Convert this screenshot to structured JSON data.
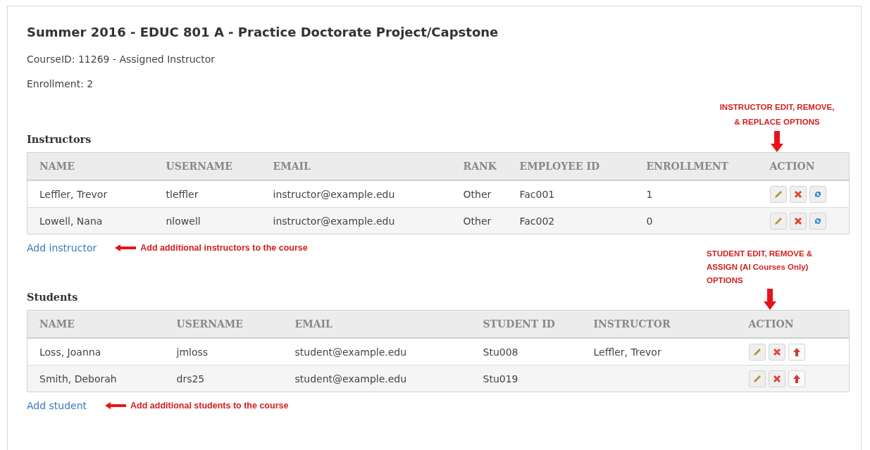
{
  "title": "Summer 2016 - EDUC 801 A - Practice Doctorate Project/Capstone",
  "course_info": "CourseID: 11269 - Assigned Instructor",
  "enrollment": "Enrollment: 2",
  "sections": [
    {
      "heading": "Instructors",
      "annotation": [
        "INSTRUCTOR EDIT, REMOVE,",
        "& REPLACE OPTIONS"
      ],
      "kind": "instructors",
      "columns": [
        "NAME",
        "USERNAME",
        "EMAIL",
        "RANK",
        "EMPLOYEE ID",
        "ENROLLMENT",
        "ACTION"
      ],
      "rows": [
        {
          "cells": [
            "Leffler, Trevor",
            "tleffler",
            "instructor@example.edu",
            "Other",
            "Fac001",
            "1"
          ],
          "actions": [
            {
              "kind": "edit"
            },
            {
              "kind": "remove"
            },
            {
              "kind": "replace"
            }
          ]
        },
        {
          "cells": [
            "Lowell, Nana",
            "nlowell",
            "instructor@example.edu",
            "Other",
            "Fac002",
            "0"
          ],
          "actions": [
            {
              "kind": "edit"
            },
            {
              "kind": "remove"
            },
            {
              "kind": "replace"
            }
          ]
        }
      ],
      "add_link": "Add instructor",
      "add_note": "Add additional instructors to the course"
    },
    {
      "heading": "Students",
      "annotation": [
        "STUDENT EDIT, REMOVE &",
        "ASSIGN (AI Courses Only)",
        "OPTIONS"
      ],
      "kind": "students",
      "columns": [
        "NAME",
        "USERNAME",
        "EMAIL",
        "STUDENT ID",
        "INSTRUCTOR",
        "ACTION"
      ],
      "rows": [
        {
          "cells": [
            "Loss, Joanna",
            "jmloss",
            "student@example.edu",
            "Stu008",
            "Leffler, Trevor"
          ],
          "actions": [
            {
              "kind": "edit"
            },
            {
              "kind": "remove"
            },
            {
              "kind": "assign"
            }
          ]
        },
        {
          "cells": [
            "Smith, Deborah",
            "drs25",
            "student@example.edu",
            "Stu019",
            ""
          ],
          "actions": [
            {
              "kind": "edit"
            },
            {
              "kind": "remove"
            },
            {
              "kind": "assign"
            }
          ]
        }
      ],
      "add_link": "Add student",
      "add_note": "Add additional students to the course"
    }
  ]
}
